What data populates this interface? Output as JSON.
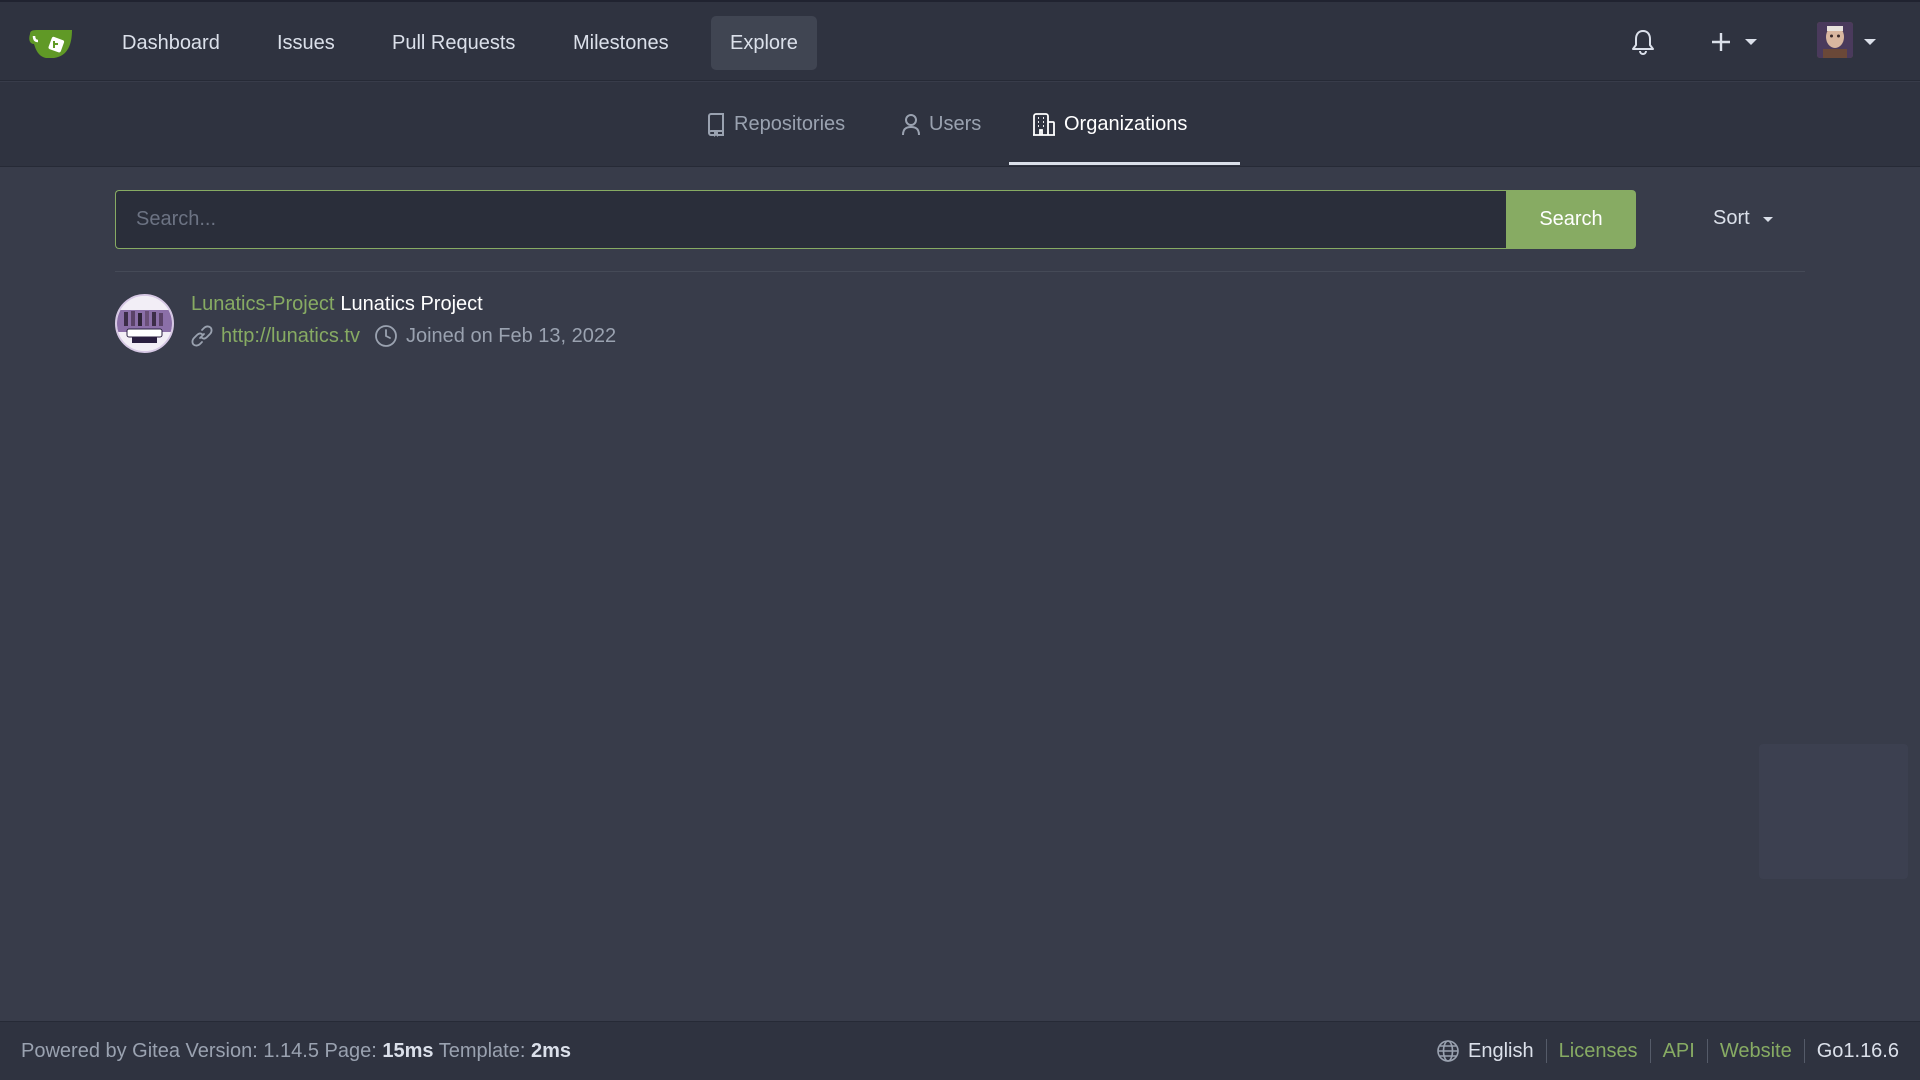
{
  "nav": {
    "items": [
      {
        "label": "Dashboard"
      },
      {
        "label": "Issues"
      },
      {
        "label": "Pull Requests"
      },
      {
        "label": "Milestones"
      },
      {
        "label": "Explore"
      }
    ],
    "active": "Explore"
  },
  "tabs": [
    {
      "label": "Repositories",
      "icon": "repo-icon"
    },
    {
      "label": "Users",
      "icon": "person-icon"
    },
    {
      "label": "Organizations",
      "icon": "organization-icon"
    }
  ],
  "active_tab": "Organizations",
  "search": {
    "placeholder": "Search...",
    "value": "",
    "button_label": "Search"
  },
  "sort": {
    "label": "Sort"
  },
  "organizations": [
    {
      "name": "Lunatics-Project",
      "full_name": "Lunatics Project",
      "website": "http://lunatics.tv",
      "joined": "Joined on Feb 13, 2022"
    }
  ],
  "footer": {
    "powered": "Powered by Gitea Version: 1.14.5 Page:",
    "page_time": "15ms",
    "template_label": "Template:",
    "template_time": "2ms",
    "language": "English",
    "links": [
      "Licenses",
      "API",
      "Website"
    ],
    "go_version": "Go1.16.6"
  },
  "colors": {
    "accent": "#87ab63",
    "background": "#383c4a",
    "header": "#2f3340"
  }
}
